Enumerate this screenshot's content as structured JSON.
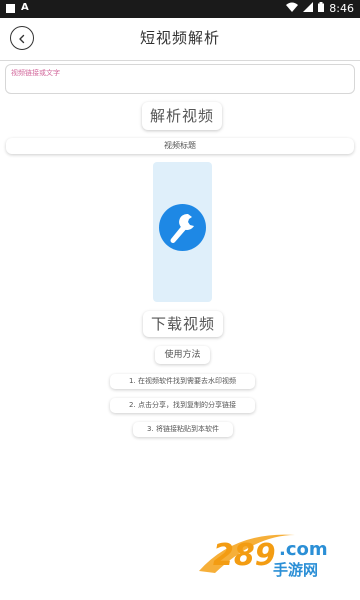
{
  "status_bar": {
    "time": "8:46"
  },
  "header": {
    "title": "短视频解析"
  },
  "input": {
    "placeholder": "视频链接或文字"
  },
  "buttons": {
    "parse": "解析视频",
    "download": "下载视频",
    "usage": "使用方法"
  },
  "video_title": "视频标题",
  "steps": [
    "1. 在视频软件找到需要去水印视频",
    "2. 点击分享，找到复制的分享链接",
    "3. 将链接粘贴到本软件"
  ],
  "watermark": {
    "brand": "289",
    "suffix": ".com",
    "caption": "手游网"
  },
  "colors": {
    "accent_blue": "#1e88e5",
    "preview_bg": "#dfeffa",
    "placeholder_pink": "#d2679b",
    "status_bar": "#1a1a1a"
  },
  "icons": {
    "back": "chevron-left-icon",
    "tool": "wrench-icon",
    "wifi": "wifi-icon",
    "signal": "signal-icon",
    "battery": "battery-icon"
  }
}
